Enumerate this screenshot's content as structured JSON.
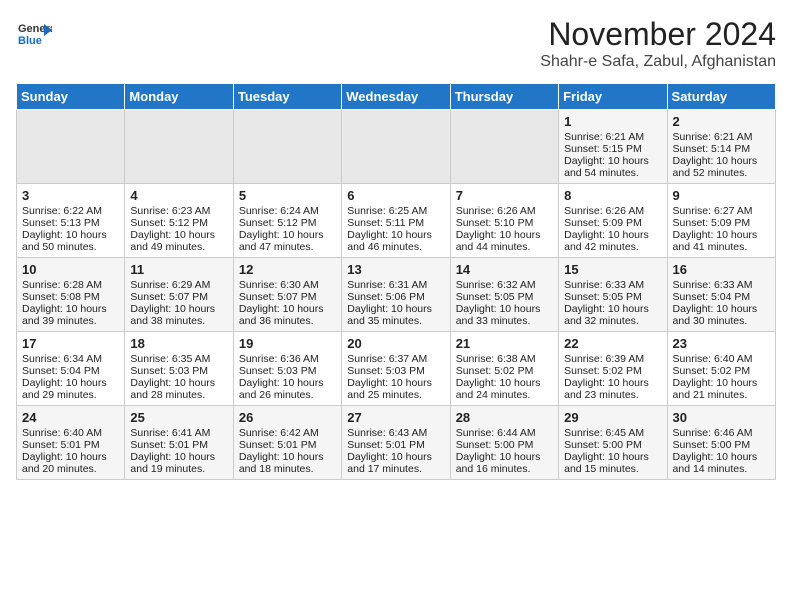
{
  "header": {
    "logo_line1": "General",
    "logo_line2": "Blue",
    "month": "November 2024",
    "location": "Shahr-e Safa, Zabul, Afghanistan"
  },
  "weekdays": [
    "Sunday",
    "Monday",
    "Tuesday",
    "Wednesday",
    "Thursday",
    "Friday",
    "Saturday"
  ],
  "weeks": [
    [
      {
        "day": "",
        "empty": true
      },
      {
        "day": "",
        "empty": true
      },
      {
        "day": "",
        "empty": true
      },
      {
        "day": "",
        "empty": true
      },
      {
        "day": "",
        "empty": true
      },
      {
        "day": "1",
        "sunrise": "6:21 AM",
        "sunset": "5:15 PM",
        "daylight": "10 hours and 54 minutes."
      },
      {
        "day": "2",
        "sunrise": "6:21 AM",
        "sunset": "5:14 PM",
        "daylight": "10 hours and 52 minutes."
      }
    ],
    [
      {
        "day": "3",
        "sunrise": "6:22 AM",
        "sunset": "5:13 PM",
        "daylight": "10 hours and 50 minutes."
      },
      {
        "day": "4",
        "sunrise": "6:23 AM",
        "sunset": "5:12 PM",
        "daylight": "10 hours and 49 minutes."
      },
      {
        "day": "5",
        "sunrise": "6:24 AM",
        "sunset": "5:12 PM",
        "daylight": "10 hours and 47 minutes."
      },
      {
        "day": "6",
        "sunrise": "6:25 AM",
        "sunset": "5:11 PM",
        "daylight": "10 hours and 46 minutes."
      },
      {
        "day": "7",
        "sunrise": "6:26 AM",
        "sunset": "5:10 PM",
        "daylight": "10 hours and 44 minutes."
      },
      {
        "day": "8",
        "sunrise": "6:26 AM",
        "sunset": "5:09 PM",
        "daylight": "10 hours and 42 minutes."
      },
      {
        "day": "9",
        "sunrise": "6:27 AM",
        "sunset": "5:09 PM",
        "daylight": "10 hours and 41 minutes."
      }
    ],
    [
      {
        "day": "10",
        "sunrise": "6:28 AM",
        "sunset": "5:08 PM",
        "daylight": "10 hours and 39 minutes."
      },
      {
        "day": "11",
        "sunrise": "6:29 AM",
        "sunset": "5:07 PM",
        "daylight": "10 hours and 38 minutes."
      },
      {
        "day": "12",
        "sunrise": "6:30 AM",
        "sunset": "5:07 PM",
        "daylight": "10 hours and 36 minutes."
      },
      {
        "day": "13",
        "sunrise": "6:31 AM",
        "sunset": "5:06 PM",
        "daylight": "10 hours and 35 minutes."
      },
      {
        "day": "14",
        "sunrise": "6:32 AM",
        "sunset": "5:05 PM",
        "daylight": "10 hours and 33 minutes."
      },
      {
        "day": "15",
        "sunrise": "6:33 AM",
        "sunset": "5:05 PM",
        "daylight": "10 hours and 32 minutes."
      },
      {
        "day": "16",
        "sunrise": "6:33 AM",
        "sunset": "5:04 PM",
        "daylight": "10 hours and 30 minutes."
      }
    ],
    [
      {
        "day": "17",
        "sunrise": "6:34 AM",
        "sunset": "5:04 PM",
        "daylight": "10 hours and 29 minutes."
      },
      {
        "day": "18",
        "sunrise": "6:35 AM",
        "sunset": "5:03 PM",
        "daylight": "10 hours and 28 minutes."
      },
      {
        "day": "19",
        "sunrise": "6:36 AM",
        "sunset": "5:03 PM",
        "daylight": "10 hours and 26 minutes."
      },
      {
        "day": "20",
        "sunrise": "6:37 AM",
        "sunset": "5:03 PM",
        "daylight": "10 hours and 25 minutes."
      },
      {
        "day": "21",
        "sunrise": "6:38 AM",
        "sunset": "5:02 PM",
        "daylight": "10 hours and 24 minutes."
      },
      {
        "day": "22",
        "sunrise": "6:39 AM",
        "sunset": "5:02 PM",
        "daylight": "10 hours and 23 minutes."
      },
      {
        "day": "23",
        "sunrise": "6:40 AM",
        "sunset": "5:02 PM",
        "daylight": "10 hours and 21 minutes."
      }
    ],
    [
      {
        "day": "24",
        "sunrise": "6:40 AM",
        "sunset": "5:01 PM",
        "daylight": "10 hours and 20 minutes."
      },
      {
        "day": "25",
        "sunrise": "6:41 AM",
        "sunset": "5:01 PM",
        "daylight": "10 hours and 19 minutes."
      },
      {
        "day": "26",
        "sunrise": "6:42 AM",
        "sunset": "5:01 PM",
        "daylight": "10 hours and 18 minutes."
      },
      {
        "day": "27",
        "sunrise": "6:43 AM",
        "sunset": "5:01 PM",
        "daylight": "10 hours and 17 minutes."
      },
      {
        "day": "28",
        "sunrise": "6:44 AM",
        "sunset": "5:00 PM",
        "daylight": "10 hours and 16 minutes."
      },
      {
        "day": "29",
        "sunrise": "6:45 AM",
        "sunset": "5:00 PM",
        "daylight": "10 hours and 15 minutes."
      },
      {
        "day": "30",
        "sunrise": "6:46 AM",
        "sunset": "5:00 PM",
        "daylight": "10 hours and 14 minutes."
      }
    ]
  ]
}
